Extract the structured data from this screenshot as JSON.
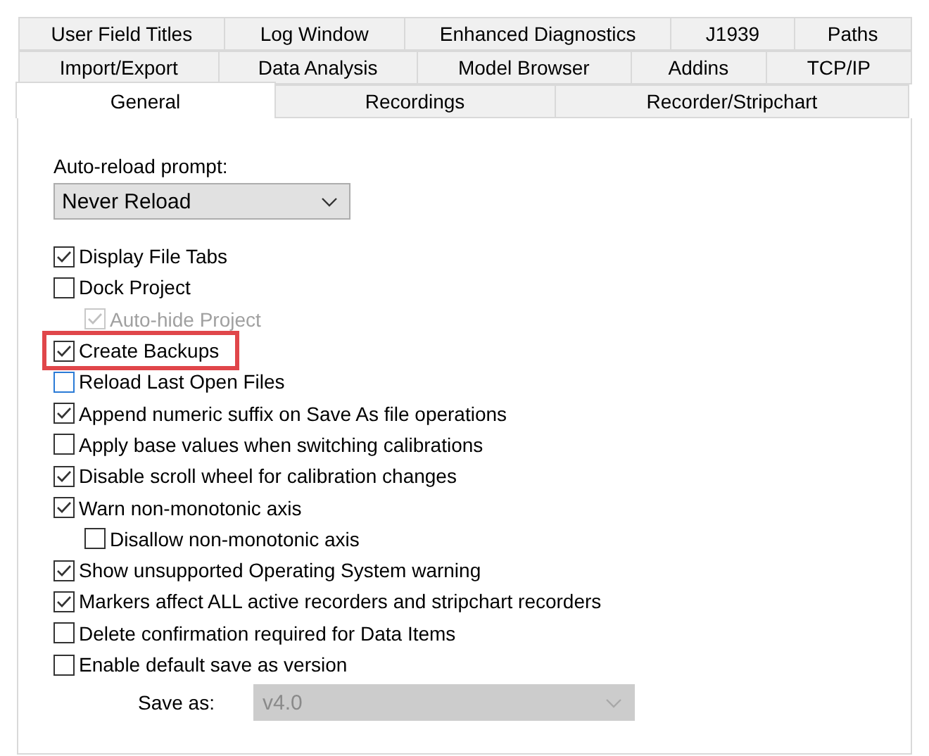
{
  "tab_rows": [
    [
      {
        "label": "User Field Titles",
        "selected": false
      },
      {
        "label": "Log Window",
        "selected": false
      },
      {
        "label": "Enhanced Diagnostics",
        "selected": false
      },
      {
        "label": "J1939",
        "selected": false
      },
      {
        "label": "Paths",
        "selected": false
      }
    ],
    [
      {
        "label": "Import/Export",
        "selected": false
      },
      {
        "label": "Data Analysis",
        "selected": false
      },
      {
        "label": "Model Browser",
        "selected": false
      },
      {
        "label": "Addins",
        "selected": false
      },
      {
        "label": "TCP/IP",
        "selected": false
      }
    ],
    [
      {
        "label": "General",
        "selected": true
      },
      {
        "label": "Recordings",
        "selected": false
      },
      {
        "label": "Recorder/Stripchart",
        "selected": false
      }
    ]
  ],
  "auto_reload": {
    "label": "Auto-reload prompt:",
    "value": "Never Reload",
    "disabled": false
  },
  "options": [
    {
      "label": "Display File Tabs",
      "checked": true,
      "disabled": false,
      "focused": false,
      "highlighted": false
    },
    {
      "label": "Dock Project",
      "checked": false,
      "disabled": false,
      "focused": false,
      "highlighted": false,
      "children": [
        {
          "label": "Auto-hide Project",
          "checked": true,
          "disabled": true,
          "focused": false,
          "highlighted": false
        }
      ]
    },
    {
      "label": "Create Backups",
      "checked": true,
      "disabled": false,
      "focused": false,
      "highlighted": true
    },
    {
      "label": "Reload Last Open Files",
      "checked": false,
      "disabled": false,
      "focused": true,
      "highlighted": false
    },
    {
      "label": "Append numeric suffix on Save As file operations",
      "checked": true,
      "disabled": false,
      "focused": false,
      "highlighted": false
    },
    {
      "label": "Apply base values when switching calibrations",
      "checked": false,
      "disabled": false,
      "focused": false,
      "highlighted": false
    },
    {
      "label": "Disable scroll wheel for calibration changes",
      "checked": true,
      "disabled": false,
      "focused": false,
      "highlighted": false
    },
    {
      "label": "Warn non-monotonic axis",
      "checked": true,
      "disabled": false,
      "focused": false,
      "highlighted": false,
      "children": [
        {
          "label": "Disallow non-monotonic axis",
          "checked": false,
          "disabled": false,
          "focused": false,
          "highlighted": false
        }
      ]
    },
    {
      "label": "Show unsupported Operating System warning",
      "checked": true,
      "disabled": false,
      "focused": false,
      "highlighted": false
    },
    {
      "label": "Markers affect ALL active recorders and stripchart recorders",
      "checked": true,
      "disabled": false,
      "focused": false,
      "highlighted": false
    },
    {
      "label": "Delete confirmation required for Data Items",
      "checked": false,
      "disabled": false,
      "focused": false,
      "highlighted": false
    },
    {
      "label": "Enable default save as version",
      "checked": false,
      "disabled": false,
      "focused": false,
      "highlighted": false
    }
  ],
  "save_as": {
    "label": "Save as:",
    "value": "v4.0",
    "disabled": true
  }
}
